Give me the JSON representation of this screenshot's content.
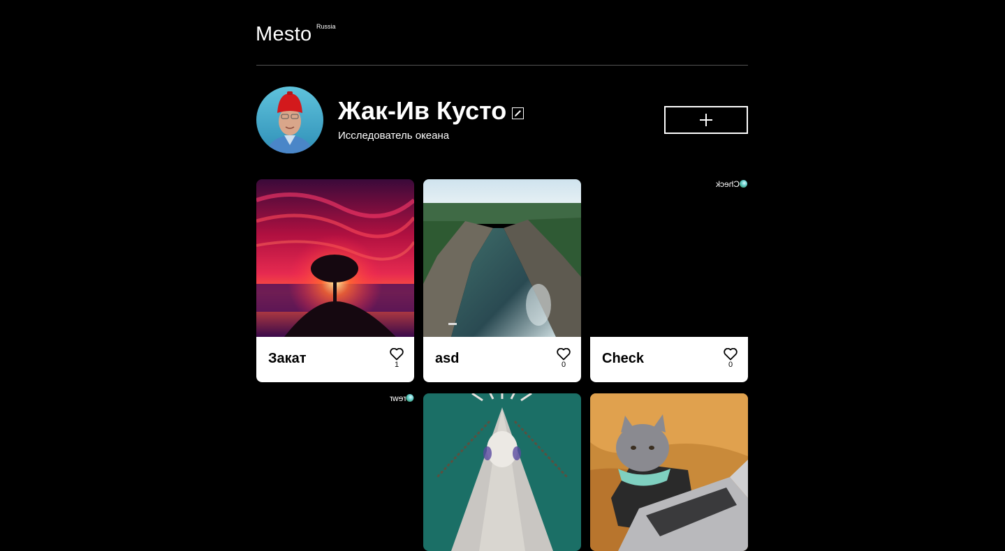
{
  "header": {
    "logo": "Mesto",
    "logo_sup": "Russia"
  },
  "profile": {
    "name": "Жак-Ив Кусто",
    "about": "Исследователь океана"
  },
  "cards": [
    {
      "title": "Закат",
      "likes": "1",
      "image": "sunset-tree"
    },
    {
      "title": "asd",
      "likes": "0",
      "image": "river-canyon"
    },
    {
      "title": "Check",
      "likes": "0",
      "image_alt": "Check",
      "image_broken": true
    },
    {
      "title": "",
      "image_alt": "rewr",
      "image_broken": true
    },
    {
      "title": "",
      "image": "fluffy-moth"
    },
    {
      "title": "",
      "image": "cat-laptop"
    }
  ],
  "icons": {
    "edit": "pencil-icon",
    "add": "plus-icon",
    "like": "heart-outline-icon"
  },
  "colors": {
    "background": "#000000",
    "card": "#ffffff",
    "divider": "#545454"
  }
}
